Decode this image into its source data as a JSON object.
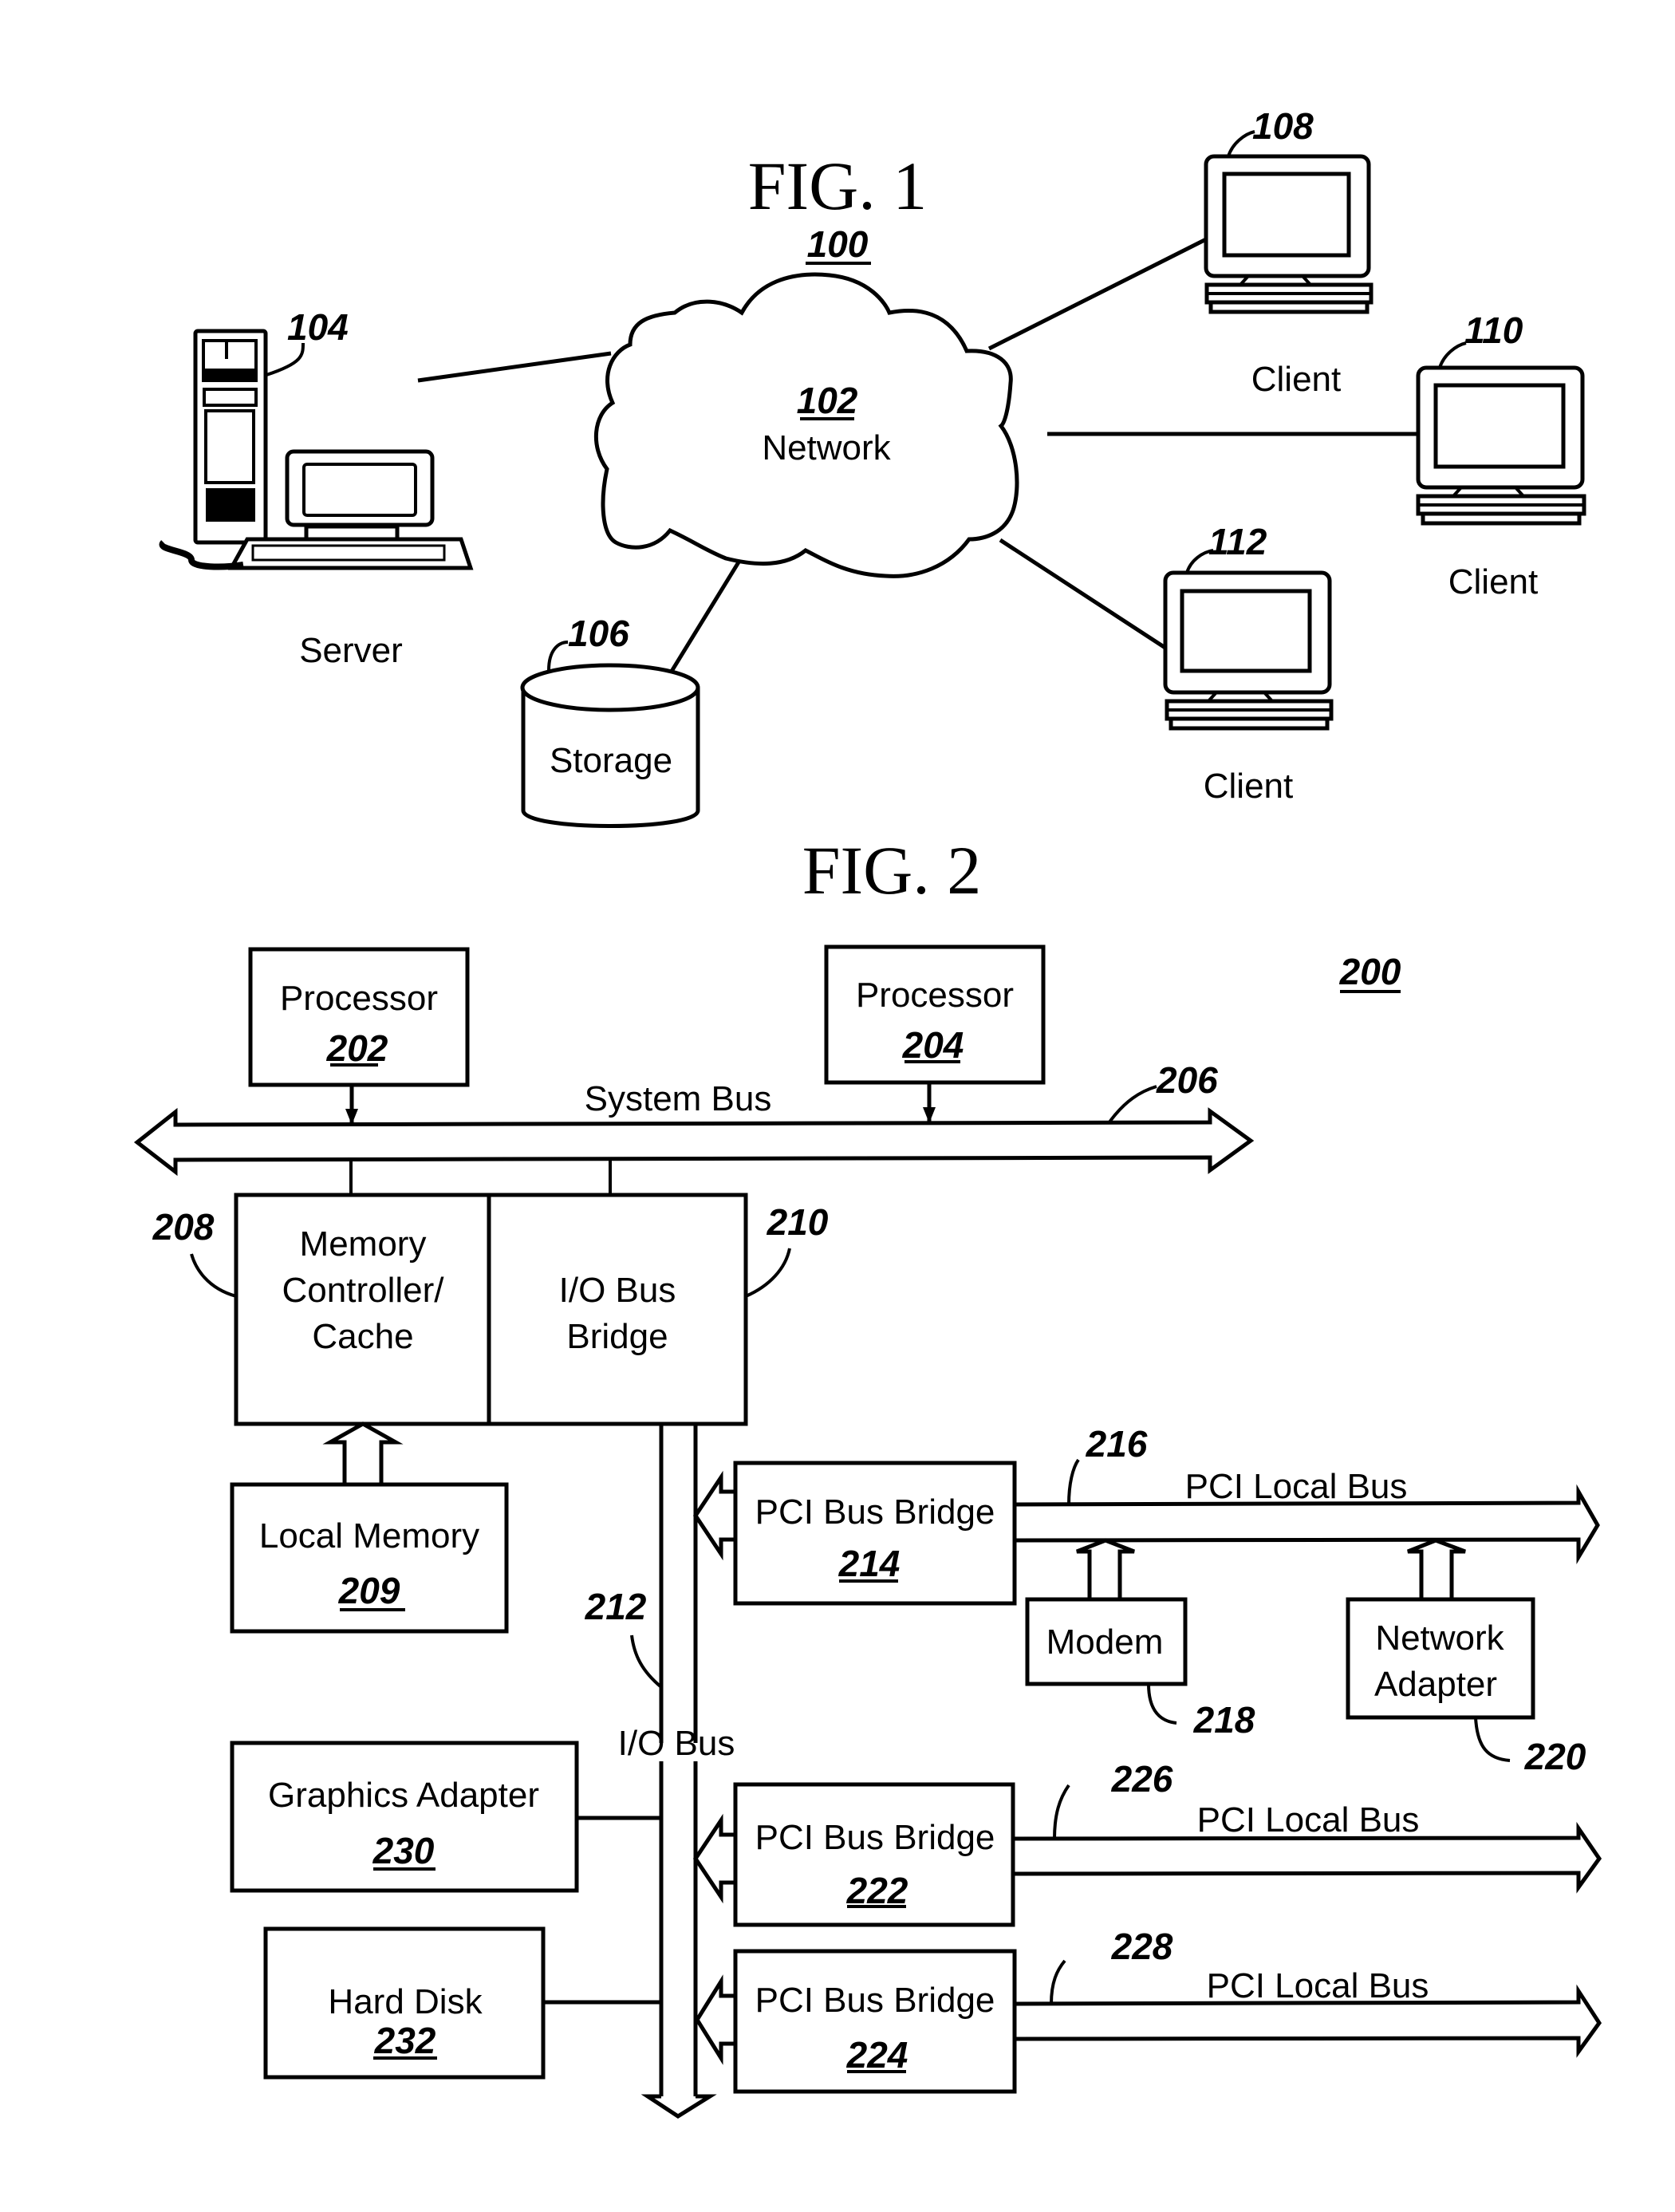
{
  "fig1": {
    "title": "FIG. 1",
    "ref": "100",
    "network": {
      "ref": "102",
      "label": "Network"
    },
    "server": {
      "ref": "104",
      "label": "Server"
    },
    "storage": {
      "ref": "106",
      "label": "Storage"
    },
    "clients": [
      {
        "ref": "108",
        "label": "Client"
      },
      {
        "ref": "110",
        "label": "Client"
      },
      {
        "ref": "112",
        "label": "Client"
      }
    ]
  },
  "fig2": {
    "title": "FIG. 2",
    "ref": "200",
    "processor1": {
      "label": "Processor",
      "ref": "202"
    },
    "processor2": {
      "label": "Processor",
      "ref": "204"
    },
    "system_bus": {
      "label": "System Bus",
      "ref": "206"
    },
    "memory_controller": {
      "line1": "Memory",
      "line2": "Controller/",
      "line3": "Cache",
      "ref": "208"
    },
    "io_bridge": {
      "line1": "I/O Bus",
      "line2": "Bridge",
      "ref": "210"
    },
    "local_memory": {
      "label": "Local Memory",
      "ref": "209"
    },
    "io_bus": {
      "label": "I/O Bus",
      "ref": "212"
    },
    "pci_bridge_1": {
      "label": "PCI Bus Bridge",
      "ref": "214"
    },
    "pci_local_bus_1": {
      "label": "PCI Local Bus",
      "ref": "216"
    },
    "modem": {
      "label": "Modem",
      "ref": "218"
    },
    "network_adapter": {
      "line1": "Network",
      "line2": "Adapter",
      "ref": "220"
    },
    "pci_bridge_2": {
      "label": "PCI Bus Bridge",
      "ref": "222"
    },
    "pci_local_bus_2": {
      "label": "PCI Local Bus",
      "ref": "226"
    },
    "pci_bridge_3": {
      "label": "PCI Bus Bridge",
      "ref": "224"
    },
    "pci_local_bus_3": {
      "label": "PCI Local Bus",
      "ref": "228"
    },
    "graphics_adapter": {
      "label": "Graphics Adapter",
      "ref": "230"
    },
    "hard_disk": {
      "label": "Hard Disk",
      "ref": "232"
    }
  }
}
